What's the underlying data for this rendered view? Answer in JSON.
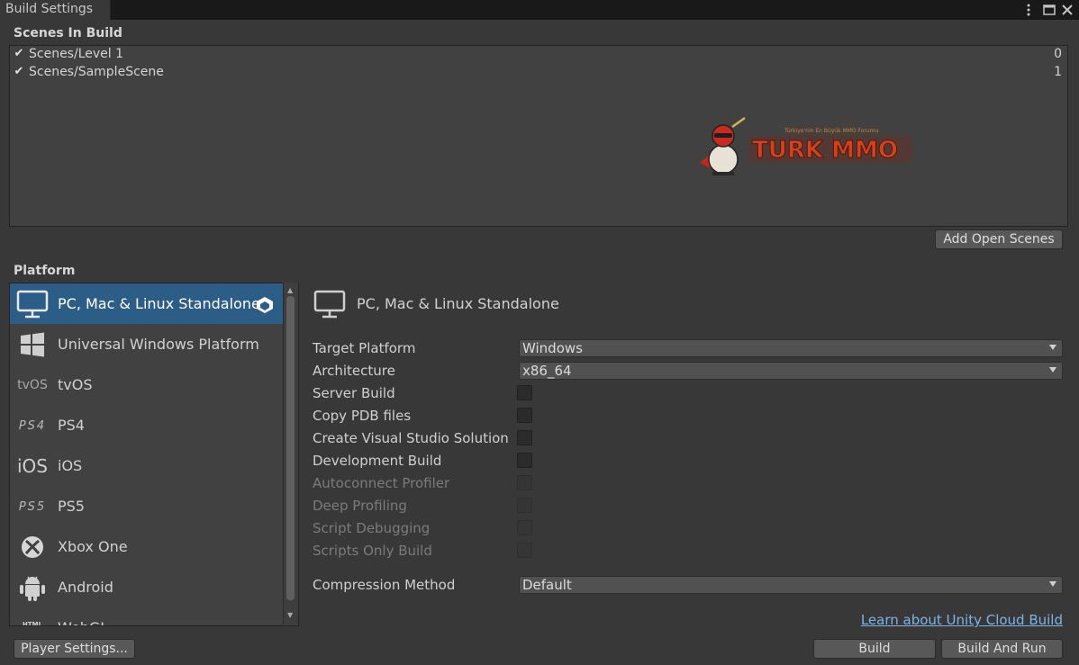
{
  "window": {
    "tab_title": "Build Settings"
  },
  "scenes": {
    "header": "Scenes In Build",
    "items": [
      {
        "name": "Scenes/Level 1",
        "index": "0",
        "checked": true
      },
      {
        "name": "Scenes/SampleScene",
        "index": "1",
        "checked": true
      }
    ],
    "add_open_scenes_label": "Add Open Scenes"
  },
  "watermark": {
    "text": "TURK MMO",
    "tagline": "Türkiye'nin En Büyük MMO Forumu"
  },
  "platform": {
    "header": "Platform",
    "items": [
      {
        "label": "PC, Mac & Linux Standalone",
        "icon": "monitor-icon",
        "selected": true
      },
      {
        "label": "Universal Windows Platform",
        "icon": "windows-logo-icon",
        "selected": false
      },
      {
        "label": "tvOS",
        "icon": "tvos-icon",
        "icon_text": "tvOS",
        "selected": false
      },
      {
        "label": "PS4",
        "icon": "ps4-icon",
        "icon_text": "PS4",
        "selected": false
      },
      {
        "label": "iOS",
        "icon": "ios-icon",
        "icon_text": "iOS",
        "selected": false
      },
      {
        "label": "PS5",
        "icon": "ps5-icon",
        "icon_text": "PS5",
        "selected": false
      },
      {
        "label": "Xbox One",
        "icon": "xbox-icon",
        "selected": false
      },
      {
        "label": "Android",
        "icon": "android-icon",
        "selected": false
      },
      {
        "label": "WebGL",
        "icon": "html5-icon",
        "icon_text": "HTML",
        "selected": false
      }
    ]
  },
  "settings": {
    "platform_title": "PC, Mac & Linux Standalone",
    "target_platform": {
      "label": "Target Platform",
      "value": "Windows"
    },
    "architecture": {
      "label": "Architecture",
      "value": "x86_64"
    },
    "checkboxes": [
      {
        "label": "Server Build",
        "checked": false,
        "enabled": true
      },
      {
        "label": "Copy PDB files",
        "checked": false,
        "enabled": true
      },
      {
        "label": "Create Visual Studio Solution",
        "checked": false,
        "enabled": true
      },
      {
        "label": "Development Build",
        "checked": false,
        "enabled": true
      },
      {
        "label": "Autoconnect Profiler",
        "checked": false,
        "enabled": false
      },
      {
        "label": "Deep Profiling",
        "checked": false,
        "enabled": false
      },
      {
        "label": "Script Debugging",
        "checked": false,
        "enabled": false
      },
      {
        "label": "Scripts Only Build",
        "checked": false,
        "enabled": false
      }
    ],
    "compression": {
      "label": "Compression Method",
      "value": "Default"
    },
    "cloud_link": "Learn about Unity Cloud Build"
  },
  "footer": {
    "player_settings_label": "Player Settings...",
    "build_label": "Build",
    "build_and_run_label": "Build And Run"
  },
  "colors": {
    "background": "#383838",
    "selection": "#2c5d87",
    "link": "#7fb2e6"
  }
}
